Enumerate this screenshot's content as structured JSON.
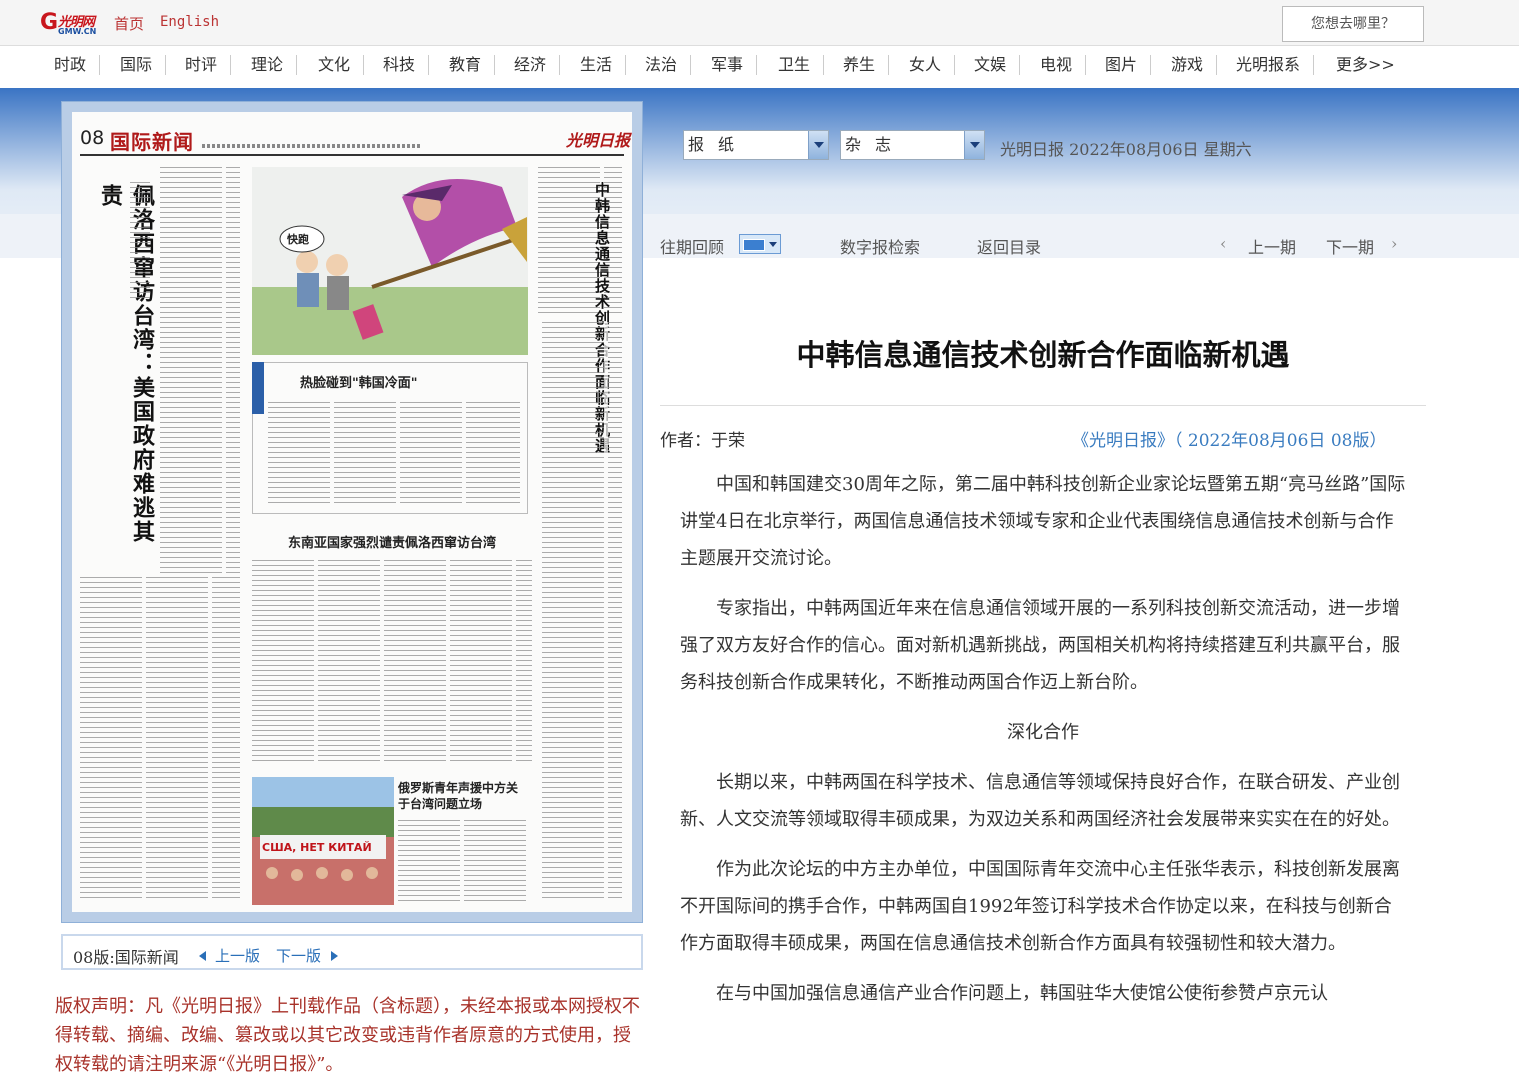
{
  "header": {
    "logo_text": "光明网",
    "logo_sub": "GMW.CN",
    "home_link": "首页",
    "english_link": "English",
    "search_placeholder": "您想去哪里？"
  },
  "nav": [
    "时政",
    "国际",
    "时评",
    "理论",
    "文化",
    "科技",
    "教育",
    "经济",
    "生活",
    "法治",
    "军事",
    "卫生",
    "养生",
    "女人",
    "文娱",
    "电视",
    "图片",
    "游戏",
    "光明报系",
    "更多>>"
  ],
  "paper_page": {
    "page_number": "08",
    "page_title": "国际新闻",
    "masthead": "光明日报",
    "headline_left": "佩洛西窜访台湾：美国政府难逃其责",
    "headline_right": "中韩信息通信技术创新合作面临新机遇",
    "sub_headline_1": "热脸碰到\"韩国冷面\"",
    "sub_headline_2": "东南亚国家强烈谴责佩洛西窜访台湾",
    "sub_headline_3": "俄罗斯青年声援中方关于台湾问题立场",
    "cartoon_caption": "快跑",
    "photo_sign": "США, НЕТ КИТАЙ"
  },
  "page_nav": {
    "label": "08版:国际新闻",
    "prev": "上一版",
    "next": "下一版"
  },
  "copyright": "版权声明：凡《光明日报》上刊载作品（含标题），未经本报或本网授权不得转载、摘编、改编、篡改或以其它改变或违背作者原意的方式使用，授权转载的请注明来源“《光明日报》”。",
  "selectors": {
    "newspaper": "报纸",
    "magazine": "杂志",
    "issue_info": "光明日报  2022年08月06日  星期六"
  },
  "toolbar": {
    "past_issues": "往期回顾",
    "digital_search": "数字报检索",
    "back_to_toc": "返回目录",
    "prev_issue": "上一期",
    "next_issue": "下一期"
  },
  "article": {
    "title": "中韩信息通信技术创新合作面临新机遇",
    "author": "作者：于荣",
    "source": "《光明日报》（ 2022年08月06日  08版）",
    "paragraphs": [
      "中国和韩国建交30周年之际，第二届中韩科技创新企业家论坛暨第五期“亮马丝路”国际讲堂4日在北京举行，两国信息通信技术领域专家和企业代表围绕信息通信技术创新与合作主题展开交流讨论。",
      "专家指出，中韩两国近年来在信息通信领域开展的一系列科技创新交流活动，进一步增强了双方友好合作的信心。面对新机遇新挑战，两国相关机构将持续搭建互利共赢平台，服务科技创新合作成果转化，不断推动两国合作迈上新台阶。"
    ],
    "section_heading": "深化合作",
    "paragraphs_2": [
      "长期以来，中韩两国在科学技术、信息通信等领域保持良好合作，在联合研发、产业创新、人文交流等领域取得丰硕成果，为双边关系和两国经济社会发展带来实实在在的好处。",
      "作为此次论坛的中方主办单位，中国国际青年交流中心主任张华表示，科技创新发展离不开国际间的携手合作，中韩两国自1992年签订科学技术合作协定以来，在科技与创新合作方面取得丰硕成果，两国在信息通信技术创新合作方面具有较强韧性和较大潜力。",
      "在与中国加强信息通信产业合作问题上，韩国驻华大使馆公使衔参赞卢京元认"
    ]
  },
  "colors": {
    "brand_red": "#c8161d",
    "link_blue": "#3a7cc0",
    "copyright_red": "#a8322a"
  }
}
